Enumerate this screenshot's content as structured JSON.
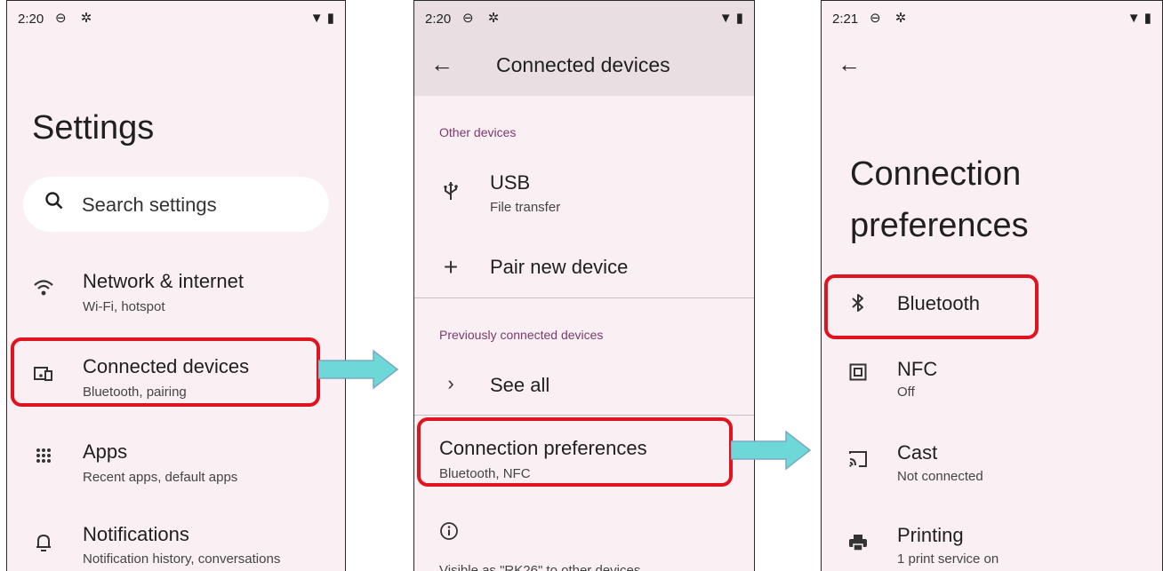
{
  "screen1": {
    "status": {
      "time": "2:20",
      "icons": "⊖ ✲",
      "right": "▼ ▮"
    },
    "title": "Settings",
    "search": {
      "icon": "search-icon",
      "placeholder": "Search settings"
    },
    "items": [
      {
        "icon": "wifi-icon",
        "title": "Network & internet",
        "subtitle": "Wi-Fi, hotspot"
      },
      {
        "icon": "devices-icon",
        "title": "Connected devices",
        "subtitle": "Bluetooth, pairing"
      },
      {
        "icon": "apps-grid-icon",
        "title": "Apps",
        "subtitle": "Recent apps, default apps"
      },
      {
        "icon": "bell-icon",
        "title": "Notifications",
        "subtitle": "Notification history, conversations"
      }
    ]
  },
  "screen2": {
    "status": {
      "time": "2:20",
      "icons": "⊖ ✲",
      "right": "▼ ▮"
    },
    "appbar_title": "Connected devices",
    "section_other": "Other devices",
    "usb": {
      "title": "USB",
      "subtitle": "File transfer"
    },
    "pair": {
      "title": "Pair new device"
    },
    "section_previous": "Previously connected devices",
    "see_all": "See all",
    "connection_prefs": {
      "title": "Connection preferences",
      "subtitle": "Bluetooth, NFC"
    },
    "footer_text": "Visible as \"RK26\" to other devices"
  },
  "screen3": {
    "status": {
      "time": "2:21",
      "icons": "⊖ ✲",
      "right": "▼ ▮"
    },
    "title_line1": "Connection",
    "title_line2": "preferences",
    "items": [
      {
        "icon": "bluetooth-icon",
        "title": "Bluetooth",
        "subtitle": ""
      },
      {
        "icon": "nfc-icon",
        "title": "NFC",
        "subtitle": "Off"
      },
      {
        "icon": "cast-icon",
        "title": "Cast",
        "subtitle": "Not connected"
      },
      {
        "icon": "printer-icon",
        "title": "Printing",
        "subtitle": "1 print service on"
      }
    ]
  },
  "colors": {
    "highlight": "#e0141e",
    "arrow": "#6ed8d8",
    "background": "#faeff2"
  }
}
